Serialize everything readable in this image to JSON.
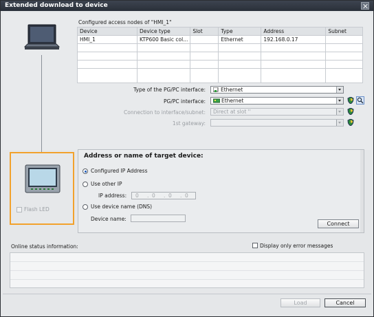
{
  "window": {
    "title": "Extended download to device"
  },
  "access_nodes": {
    "caption": "Configured access nodes of \"HMI_1\"",
    "columns": [
      "Device",
      "Device type",
      "Slot",
      "Type",
      "Address",
      "Subnet"
    ],
    "rows": [
      [
        "HMI_1",
        "KTP600 Basic col...",
        "",
        "Ethernet",
        "192.168.0.17",
        ""
      ],
      [
        "",
        "",
        "",
        "",
        "",
        ""
      ],
      [
        "",
        "",
        "",
        "",
        "",
        ""
      ],
      [
        "",
        "",
        "",
        "",
        "",
        ""
      ]
    ]
  },
  "interface": {
    "type_label": "Type of the PG/PC interface:",
    "type_value": "Ethernet",
    "pgpc_label": "PG/PC interface:",
    "pgpc_value": "Ethernet",
    "connection_label": "Connection to interface/subnet:",
    "connection_value": "Direct at slot '' ",
    "gateway_label": "1st gateway:",
    "gateway_value": ""
  },
  "target": {
    "heading": "Address or name of target device:",
    "configured_ip_label": "Configured IP Address",
    "other_ip_label": "Use other IP",
    "ip_address_label": "IP address:",
    "ip_octets": [
      "0",
      "0",
      "0",
      "0"
    ],
    "device_name_dns_label": "Use device name (DNS)",
    "device_name_label": "Device name:",
    "device_name_value": "",
    "connect_label": "Connect",
    "flash_led_label": "Flash LED"
  },
  "status": {
    "label": "Online status information:",
    "error_only_label": "Display only error messages"
  },
  "footer": {
    "load_label": "Load",
    "cancel_label": "Cancel"
  },
  "colors": {
    "title_bar": "#2f3640",
    "highlight_orange": "#f2a12b",
    "radio_accent": "#1e5bb8"
  },
  "icons": [
    "laptop-icon",
    "hmi-panel-icon",
    "ethernet-icon",
    "network-card-icon",
    "shield-icon",
    "search-icon",
    "close-icon"
  ]
}
